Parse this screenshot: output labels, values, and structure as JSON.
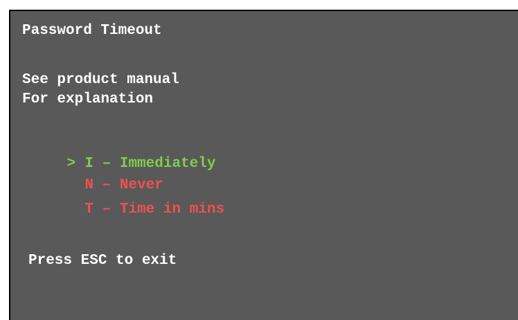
{
  "screen": {
    "title": "Password Timeout",
    "info_lines": [
      "See product manual",
      "For explanation"
    ],
    "options": [
      {
        "cursor": ">",
        "text": "I – Immediately",
        "color": "#7fce4b",
        "selected": true
      },
      {
        "cursor": "",
        "text": "N – Never",
        "color": "#f05050",
        "selected": false
      },
      {
        "cursor": "",
        "text": "T – Time in mins",
        "color": "#f05050",
        "selected": false
      }
    ],
    "footer": "Press ESC to exit"
  },
  "colors": {
    "background": "#595959",
    "text": "#ffffff",
    "selected": "#7fce4b",
    "unselected": "#f05050"
  }
}
